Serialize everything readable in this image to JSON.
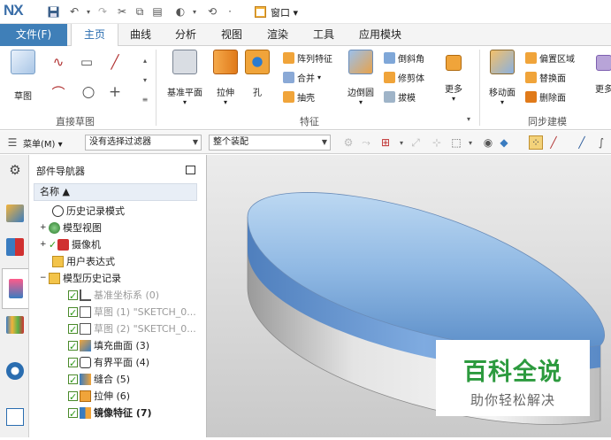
{
  "app": {
    "logo": "NX",
    "window_menu": "窗口 ▾"
  },
  "tabs": [
    "文件(F)",
    "主页",
    "曲线",
    "分析",
    "视图",
    "渲染",
    "工具",
    "应用模块"
  ],
  "ribbon": {
    "sketch_label": "草图",
    "group_direct_sketch": "直接草图",
    "datum_plane": "基准平面",
    "extrude": "拉伸",
    "hole": "孔",
    "pattern_feature": "阵列特征",
    "unite": "合并",
    "shell": "抽壳",
    "edge_blend": "边倒圆",
    "chamfer": "倒斜角",
    "trim_body": "修剪体",
    "draft": "拔模",
    "more_feature": "更多",
    "group_feature": "特征",
    "move_face": "移动面",
    "offset_region": "偏置区域",
    "replace_face": "替换面",
    "delete_face": "删除面",
    "more_sync": "更多",
    "group_sync": "同步建模"
  },
  "toolbar": {
    "menu": "菜单(M) ▾",
    "filter": "没有选择过滤器",
    "assembly": "整个装配"
  },
  "navigator": {
    "title": "部件导航器",
    "column": "名称 ▲",
    "items": [
      {
        "label": "历史记录模式"
      },
      {
        "label": "模型视图"
      },
      {
        "label": "摄像机"
      },
      {
        "label": "用户表达式"
      },
      {
        "label": "模型历史记录"
      },
      {
        "label": "基准坐标系 (0)"
      },
      {
        "label": "草图 (1) \"SKETCH_0..."
      },
      {
        "label": "草图 (2) \"SKETCH_0..."
      },
      {
        "label": "填充曲面 (3)"
      },
      {
        "label": "有界平面 (4)"
      },
      {
        "label": "缝合 (5)"
      },
      {
        "label": "拉伸 (6)"
      },
      {
        "label": "镜像特征 (7)"
      }
    ]
  },
  "watermark": {
    "main": "百科全说",
    "sub": "助你轻松解决"
  },
  "colors": {
    "file_tab": "#3f7fb8",
    "active_tab_text": "#2a6db0",
    "watermark_green": "#2c9a3e"
  }
}
